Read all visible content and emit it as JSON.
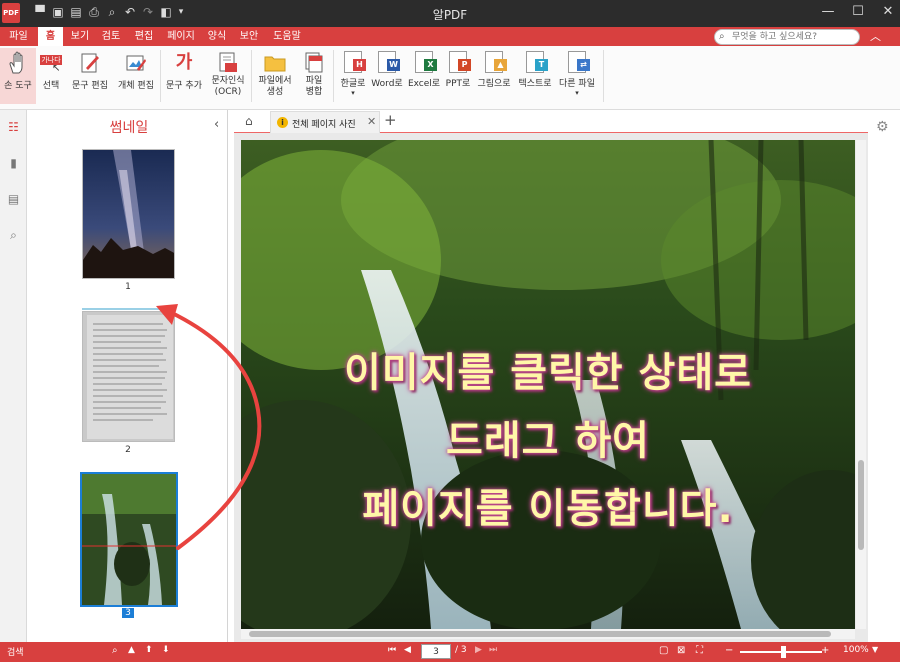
{
  "window": {
    "title": "알PDF",
    "logo_text": "PDF"
  },
  "menu": {
    "items": [
      "파일",
      "홈",
      "보기",
      "검토",
      "편집",
      "페이지",
      "양식",
      "보안",
      "도움말"
    ],
    "search_placeholder": "무엇을 하고 싶으세요?"
  },
  "ribbon": {
    "hand_tool": "손 도구",
    "select": "선택",
    "select_icon_text": "가나다",
    "text_edit": "문구 편집",
    "object_edit": "개체 편집",
    "add_text": "문구 추가",
    "add_text_icon_text": "가",
    "ocr_line1": "문자인식",
    "ocr_line2": "(OCR)",
    "from_file_line1": "파일에서",
    "from_file_line2": "생성",
    "merge_line1": "파일",
    "merge_line2": "병합",
    "to_hangul": "한글로",
    "to_word": "Word로",
    "to_excel": "Excel로",
    "to_ppt": "PPT로",
    "to_image": "그림으로",
    "to_text": "텍스트로",
    "to_other": "다른 파일",
    "dropdown_arrow": "▾",
    "convert_tags": {
      "hangul": "H",
      "word": "W",
      "excel": "X",
      "ppt": "P",
      "image": "▲",
      "text": "T"
    }
  },
  "thumbnail_panel": {
    "title": "썸네일",
    "pages": [
      "1",
      "2",
      "3"
    ],
    "selected_page": "3"
  },
  "tabs": {
    "doc_tab": "전체 페이지 사진",
    "warn_icon_text": "i"
  },
  "document": {
    "overlay_lines": [
      "이미지를 클릭한 상태로",
      "드래그 하여",
      "페이지를 이동합니다."
    ]
  },
  "statusbar": {
    "search": "검색",
    "current_page": "3",
    "total_pages": "/ 3",
    "zoom": "100%"
  },
  "colors": {
    "accent": "#d8403f",
    "selection": "#1c7ed6",
    "arrow": "#e8433f"
  }
}
